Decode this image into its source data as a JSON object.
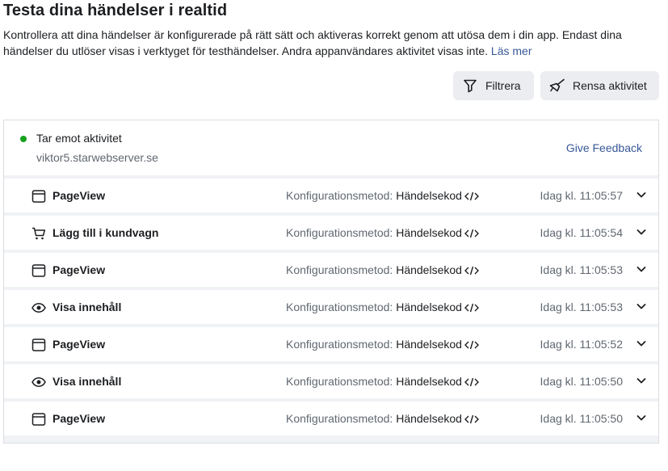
{
  "header": {
    "title": "Testa dina händelser i realtid",
    "description": "Kontrollera att dina händelser är konfigurerade på rätt sätt och aktiveras korrekt genom att utösa dem i din app. Endast dina händelser du utlöser visas i verktyget för testhändelser. Andra appanvändares aktivitet visas inte.",
    "learn_more": "Läs mer"
  },
  "toolbar": {
    "filter_label": "Filtrera",
    "clear_label": "Rensa aktivitet"
  },
  "status": {
    "label": "Tar emot aktivitet",
    "host": "viktor5.starwebserver.se",
    "feedback": "Give Feedback",
    "color": "#15a11b"
  },
  "method_prefix": "Konfigurationsmetod:",
  "events": [
    {
      "icon": "browser-window-icon",
      "name": "PageView",
      "method": "Händelsekod",
      "time": "Idag kl. 11:05:57"
    },
    {
      "icon": "shopping-cart-icon",
      "name": "Lägg till i kundvagn",
      "method": "Händelsekod",
      "time": "Idag kl. 11:05:54"
    },
    {
      "icon": "browser-window-icon",
      "name": "PageView",
      "method": "Händelsekod",
      "time": "Idag kl. 11:05:53"
    },
    {
      "icon": "eye-icon",
      "name": "Visa innehåll",
      "method": "Händelsekod",
      "time": "Idag kl. 11:05:53"
    },
    {
      "icon": "browser-window-icon",
      "name": "PageView",
      "method": "Händelsekod",
      "time": "Idag kl. 11:05:52"
    },
    {
      "icon": "eye-icon",
      "name": "Visa innehåll",
      "method": "Händelsekod",
      "time": "Idag kl. 11:05:50"
    },
    {
      "icon": "browser-window-icon",
      "name": "PageView",
      "method": "Händelsekod",
      "time": "Idag kl. 11:05:50"
    }
  ]
}
